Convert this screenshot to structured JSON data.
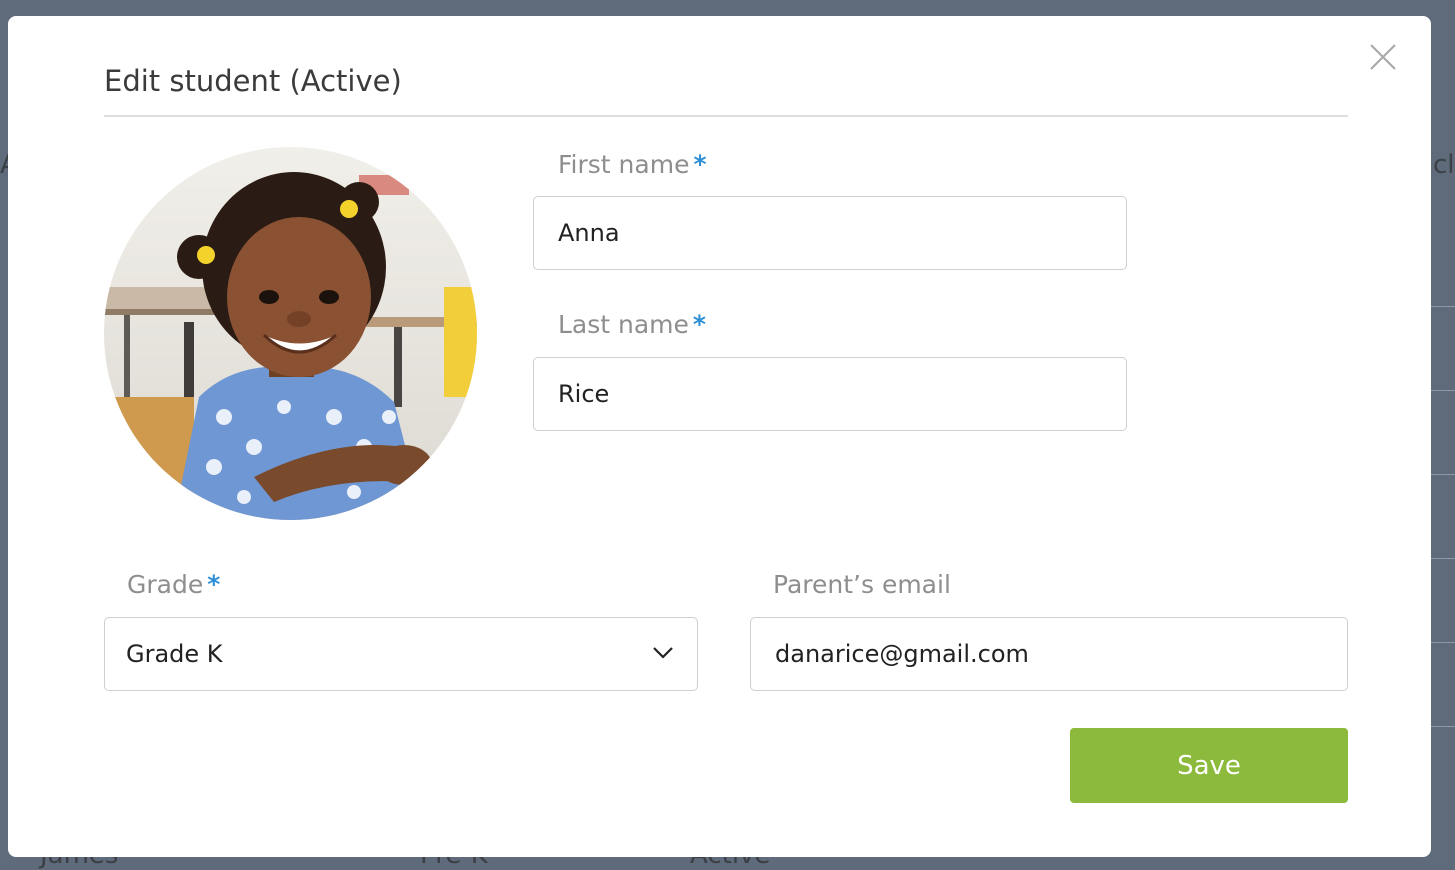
{
  "modal": {
    "title": "Edit student (Active)",
    "photo_alt": "Student photo"
  },
  "form": {
    "first_name": {
      "label": "First name",
      "required_mark": "*",
      "value": "Anna"
    },
    "last_name": {
      "label": "Last name",
      "required_mark": "*",
      "value": "Rice"
    },
    "grade": {
      "label": "Grade",
      "required_mark": "*",
      "value": "Grade K"
    },
    "parent_email": {
      "label": "Parent’s email",
      "value": "danarice@gmail.com"
    }
  },
  "actions": {
    "save_label": "Save"
  },
  "icons": {
    "close": "close-icon",
    "dropdown": "chevron-down-icon"
  },
  "colors": {
    "accent_required": "#2e8fd6",
    "save_button": "#8cba3c",
    "overlay": "#5f6a7a"
  },
  "background": {
    "partial_texts": [
      "A",
      "cl",
      "James",
      "Pre-K",
      "Active"
    ]
  }
}
